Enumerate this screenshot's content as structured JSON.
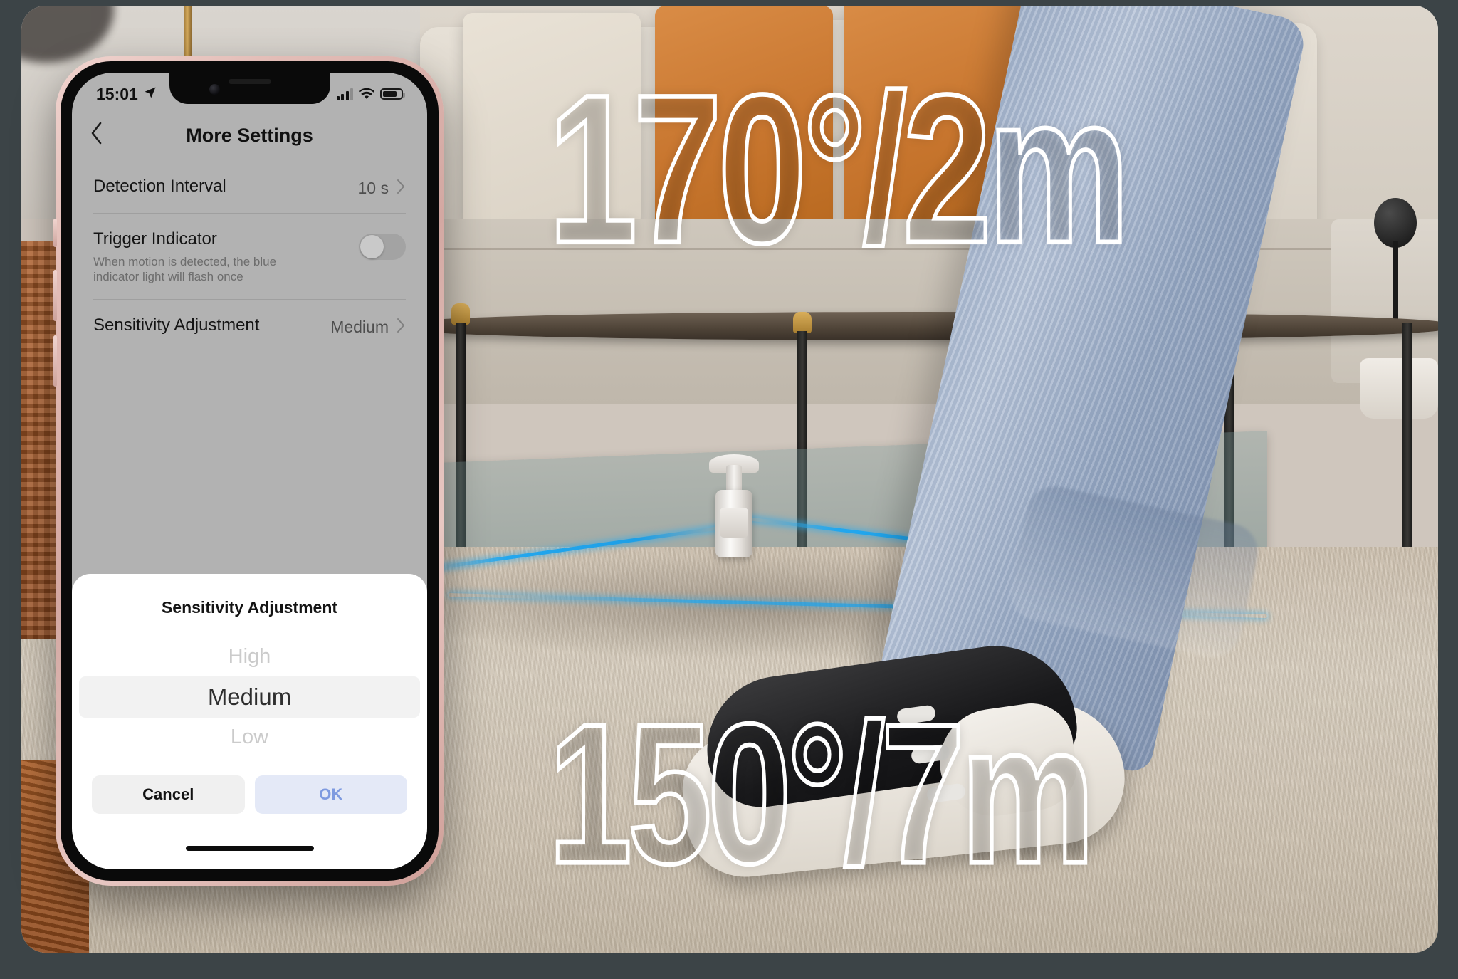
{
  "overlay": {
    "spec_top": "170°/2m",
    "spec_bottom": "150°/7m"
  },
  "phone": {
    "status_bar": {
      "time": "15:01",
      "location_icon": "location-arrow-icon",
      "cellular_icon": "cellular-bars-icon",
      "wifi_icon": "wifi-icon",
      "battery_icon": "battery-icon"
    },
    "nav": {
      "back_icon": "chevron-left-icon",
      "title": "More Settings"
    },
    "settings": [
      {
        "label": "Detection Interval",
        "value": "10 s",
        "accessory": "chevron-right-icon"
      },
      {
        "label": "Trigger Indicator",
        "description": "When motion is detected, the blue indicator light will flash once",
        "accessory": "toggle-switch",
        "toggle_on": false
      },
      {
        "label": "Sensitivity Adjustment",
        "value": "Medium",
        "accessory": "chevron-right-icon"
      }
    ],
    "sheet": {
      "title": "Sensitivity Adjustment",
      "options": [
        {
          "label": "High",
          "selected": false
        },
        {
          "label": "Medium",
          "selected": true
        },
        {
          "label": "Low",
          "selected": false
        }
      ],
      "cancel_label": "Cancel",
      "ok_label": "OK"
    }
  },
  "colors": {
    "frame": "#3c4447",
    "ok_text": "#7e9ae0",
    "ok_bg": "#e4e9f7",
    "beam": "#22a7ee",
    "dim_screen": "#b2b2b2"
  }
}
